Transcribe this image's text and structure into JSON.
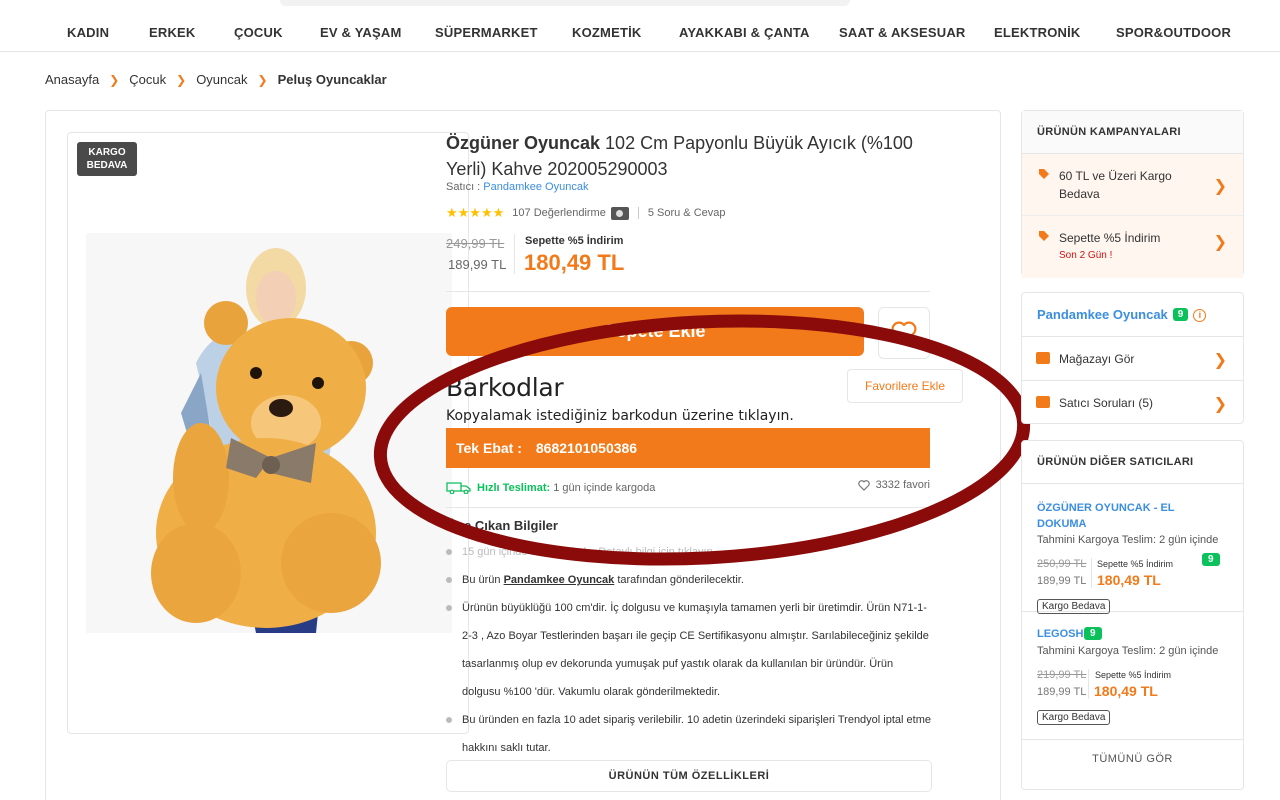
{
  "nav": {
    "items": [
      "KADIN",
      "ERKEK",
      "ÇOCUK",
      "EV & YAŞAM",
      "SÜPERMARKET",
      "KOZMETİK",
      "AYAKKABI & ÇANTA",
      "SAAT & AKSESUAR",
      "ELEKTRONİK",
      "SPOR&OUTDOOR"
    ]
  },
  "breadcrumb": [
    "Anasayfa",
    "Çocuk",
    "Oyuncak",
    "Peluş Oyuncaklar"
  ],
  "product": {
    "kargo_badge": "KARGO BEDAVA",
    "brand": "Özgüner Oyuncak",
    "title": " 102 Cm Papyonlu Büyük Ayıcık (%100 Yerli) Kahve 202005290003",
    "seller_prefix": "Satıcı : ",
    "seller": "Pandamkee Oyuncak",
    "rating_stars": "★★★★★",
    "rating_value": 4.5,
    "review_count": "107 Değerlendirme",
    "qa": "5 Soru & Cevap",
    "old_price": "249,99 TL",
    "mid_price": "189,99 TL",
    "discount_label": "Sepette %5 İndirim",
    "final_price": "180,49 TL",
    "cart_button": "Sepete Ekle",
    "fav_tooltip": "Favorilere Ekle",
    "delivery_fast": "Hızlı Teslimat:",
    "delivery_text": " 1 gün içinde kargoda",
    "fav_count": "3332 favori",
    "features_title": "Öne Çıkan Bilgiler",
    "features": [
      "15 gün içinde ücretsiz iade. Detaylı bilgi için tıklayın.",
      "Bu ürün",
      "Pandamkee Oyuncak",
      "tarafından gönderilecektir.",
      "Ürünün büyüklüğü 100 cm'dir. İç dolgusu ve kumaşıyla tamamen yerli bir üretimdir. Ürün N71-1-2-3 , Azo Boyar Testlerinden başarı ile geçip CE Sertifikasyonu almıştır. Sarılabileceğiniz şekilde tasarlanmış olup ev dekorunda yumuşak puf yastık olarak da kullanılan bir üründür. Ürün dolgusu %100 'dür. Vakumlu olarak gönderilmektedir.",
      "Bu üründen en fazla 10 adet sipariş verilebilir. 10 adetin üzerindeki siparişleri Trendyol iptal etme hakkını saklı tutar."
    ],
    "all_features_button": "ÜRÜNÜN TÜM ÖZELLİKLERİ"
  },
  "barcode": {
    "title": "Barkodlar",
    "instruction": "Kopyalamak istediğiniz barkodun üzerine tıklayın.",
    "label": "Tek Ebat :",
    "code": "8682101050386"
  },
  "campaigns": {
    "header": "ÜRÜNÜN KAMPANYALARI",
    "items": [
      {
        "text": "60 TL ve Üzeri Kargo Bedava",
        "sub": ""
      },
      {
        "text": "Sepette %5 İndirim",
        "sub": "Son 2 Gün !"
      }
    ]
  },
  "seller_card": {
    "name": "Pandamkee Oyuncak",
    "score": "9",
    "info": "i",
    "links": [
      "Mağazayı Gör",
      "Satıcı Soruları (5)"
    ]
  },
  "other_sellers": {
    "header": "ÜRÜNÜN DİĞER SATICILARI",
    "sellers": [
      {
        "name": "ÖZGÜNER OYUNCAK - EL DOKUMA",
        "score": "9",
        "eta": "Tahmini Kargoya Teslim: 2 gün içinde",
        "old_price": "250,99 TL",
        "mid_price": "189,99 TL",
        "discount": "Sepette %5 İndirim",
        "final_price": "180,49 TL",
        "badge": "Kargo Bedava"
      },
      {
        "name": "LEGOSH",
        "score": "9",
        "eta": "Tahmini Kargoya Teslim: 2 gün içinde",
        "old_price": "219,99 TL",
        "mid_price": "189,99 TL",
        "discount": "Sepette %5 İndirim",
        "final_price": "180,49 TL",
        "badge": "Kargo Bedava"
      }
    ],
    "see_all": "TÜMÜNÜ GÖR"
  },
  "colors": {
    "accent": "#f27a1a",
    "link": "#3b8ee0",
    "success": "#0bc15c",
    "annotation": "#8b0a0a"
  }
}
